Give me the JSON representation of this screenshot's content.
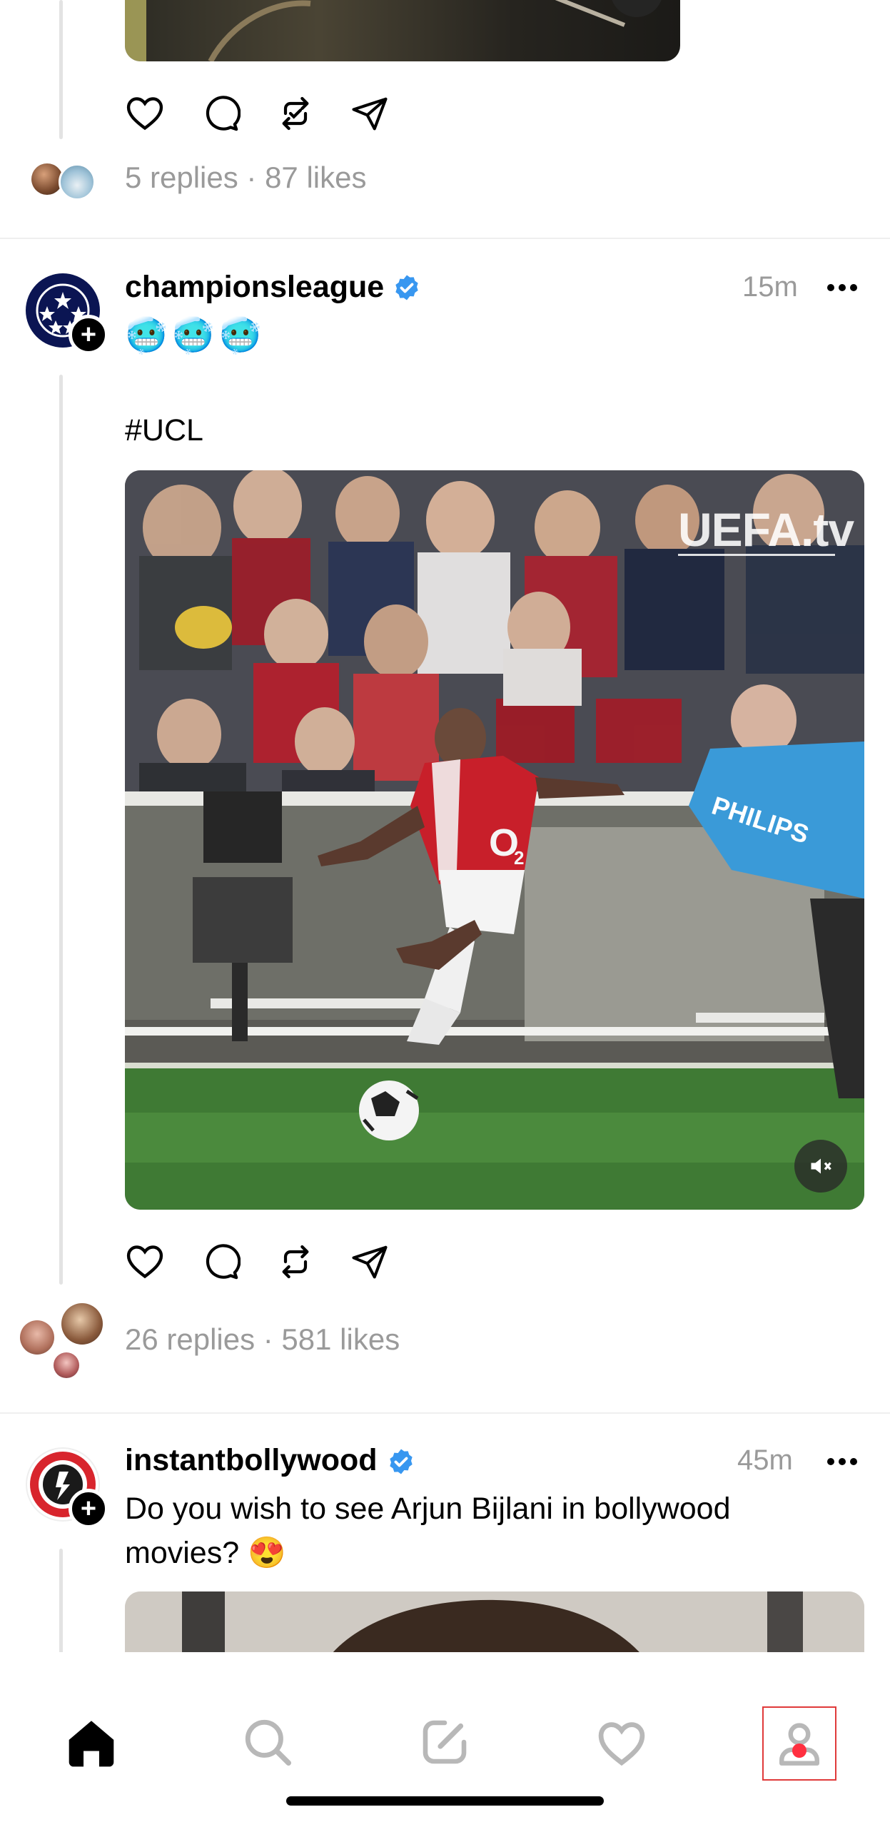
{
  "post_prev": {
    "stats": "5 replies · 87 likes"
  },
  "post_ucl": {
    "username": "championsleague",
    "time": "15m",
    "emoji_line": "🥶🥶🥶",
    "hashtag": "#UCL",
    "watermark": "UEFA.tv",
    "stats": "26 replies · 581 likes"
  },
  "post_bolly": {
    "username": "instantbollywood",
    "time": "45m",
    "text_line1": "Do you wish to see Arjun Bijlani in bollywood",
    "text_line2": "movies? 😍"
  },
  "tabbar": {
    "items": [
      "home-icon",
      "search-icon",
      "compose-icon",
      "activity-heart-icon",
      "profile-icon"
    ],
    "notification_count": "1"
  },
  "colors": {
    "verified": "#3897f0",
    "badge": "#ff3040",
    "highlight": "#e03a3a"
  }
}
